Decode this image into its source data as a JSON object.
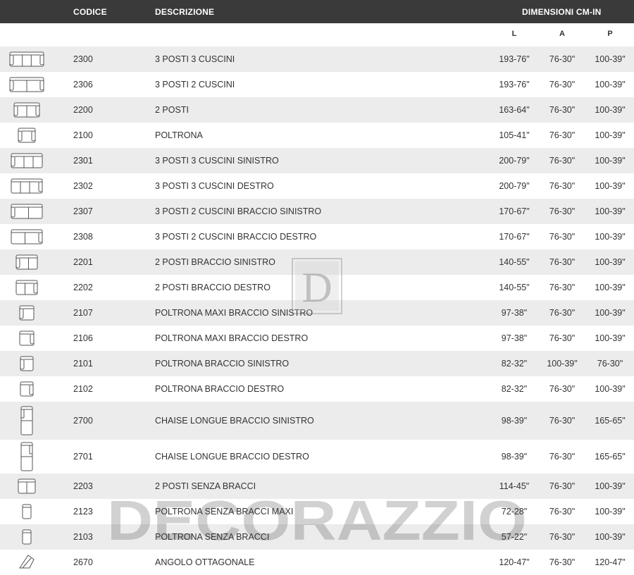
{
  "header": {
    "codice": "CODICE",
    "descrizione": "DESCRIZIONE",
    "dimensioni": "DIMENSIONI CM-IN"
  },
  "subheader": {
    "L": "L",
    "A": "A",
    "P": "P"
  },
  "watermark": {
    "text": "DECORAZZIO",
    "letter": "D"
  },
  "rows": [
    {
      "icon": "sofa-3-seat-3-cushion-icon",
      "code": "2300",
      "desc": "3 POSTI 3 CUSCINI",
      "L": "193-76\"",
      "A": "76-30\"",
      "P": "100-39\""
    },
    {
      "icon": "sofa-3-seat-2-cushion-icon",
      "code": "2306",
      "desc": "3 POSTI 2 CUSCINI",
      "L": "193-76\"",
      "A": "76-30\"",
      "P": "100-39\""
    },
    {
      "icon": "sofa-2-seat-icon",
      "code": "2200",
      "desc": "2 POSTI",
      "L": "163-64\"",
      "A": "76-30\"",
      "P": "100-39\""
    },
    {
      "icon": "armchair-icon",
      "code": "2100",
      "desc": "POLTRONA",
      "L": "105-41\"",
      "A": "76-30\"",
      "P": "100-39\""
    },
    {
      "icon": "sofa-3-seat-left-arm-icon",
      "code": "2301",
      "desc": "3 POSTI 3 CUSCINI SINISTRO",
      "L": "200-79\"",
      "A": "76-30\"",
      "P": "100-39\""
    },
    {
      "icon": "sofa-3-seat-right-arm-icon",
      "code": "2302",
      "desc": "3 POSTI 3 CUSCINI DESTRO",
      "L": "200-79\"",
      "A": "76-30\"",
      "P": "100-39\""
    },
    {
      "icon": "sofa-3-seat-2-cushion-left-arm-icon",
      "code": "2307",
      "desc": "3 POSTI 2 CUSCINI BRACCIO SINISTRO",
      "L": "170-67\"",
      "A": "76-30\"",
      "P": "100-39\""
    },
    {
      "icon": "sofa-3-seat-2-cushion-right-arm-icon",
      "code": "2308",
      "desc": "3 POSTI 2 CUSCINI BRACCIO DESTRO",
      "L": "170-67\"",
      "A": "76-30\"",
      "P": "100-39\""
    },
    {
      "icon": "sofa-2-seat-left-arm-icon",
      "code": "2201",
      "desc": "2 POSTI BRACCIO SINISTRO",
      "L": "140-55\"",
      "A": "76-30\"",
      "P": "100-39\""
    },
    {
      "icon": "sofa-2-seat-right-arm-icon",
      "code": "2202",
      "desc": "2 POSTI BRACCIO DESTRO",
      "L": "140-55\"",
      "A": "76-30\"",
      "P": "100-39\""
    },
    {
      "icon": "armchair-maxi-left-arm-icon",
      "code": "2107",
      "desc": "POLTRONA MAXI BRACCIO SINISTRO",
      "L": "97-38\"",
      "A": "76-30\"",
      "P": "100-39\""
    },
    {
      "icon": "armchair-maxi-right-arm-icon",
      "code": "2106",
      "desc": "POLTRONA MAXI BRACCIO DESTRO",
      "L": "97-38\"",
      "A": "76-30\"",
      "P": "100-39\""
    },
    {
      "icon": "armchair-left-arm-icon",
      "code": "2101",
      "desc": "POLTRONA BRACCIO SINISTRO",
      "L": "82-32\"",
      "A": "100-39\"",
      "P": "76-30\""
    },
    {
      "icon": "armchair-right-arm-icon",
      "code": "2102",
      "desc": "POLTRONA BRACCIO DESTRO",
      "L": "82-32\"",
      "A": "76-30\"",
      "P": "100-39\""
    },
    {
      "icon": "chaise-longue-left-arm-icon",
      "code": "2700",
      "desc": "CHAISE LONGUE BRACCIO SINISTRO",
      "L": "98-39\"",
      "A": "76-30\"",
      "P": "165-65\""
    },
    {
      "icon": "chaise-longue-right-arm-icon",
      "code": "2701",
      "desc": "CHAISE LONGUE BRACCIO DESTRO",
      "L": "98-39\"",
      "A": "76-30\"",
      "P": "165-65\""
    },
    {
      "icon": "sofa-2-seat-armless-icon",
      "code": "2203",
      "desc": "2 POSTI SENZA BRACCI",
      "L": "114-45\"",
      "A": "76-30\"",
      "P": "100-39\""
    },
    {
      "icon": "armchair-maxi-armless-icon",
      "code": "2123",
      "desc": "POLTRONA SENZA BRACCI MAXI",
      "L": "72-28\"",
      "A": "76-30\"",
      "P": "100-39\""
    },
    {
      "icon": "armchair-armless-icon",
      "code": "2103",
      "desc": "POLTRONA SENZA BRACCI",
      "L": "57-22\"",
      "A": "76-30\"",
      "P": "100-39\""
    },
    {
      "icon": "octagonal-corner-icon",
      "code": "2670",
      "desc": "ANGOLO OTTAGONALE",
      "L": "120-47\"",
      "A": "76-30\"",
      "P": "120-47\""
    }
  ]
}
